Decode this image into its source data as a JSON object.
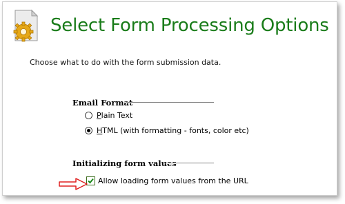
{
  "page": {
    "title": "Select Form Processing Options",
    "description": "Choose what to do with the form submission data."
  },
  "email_format": {
    "heading": "Email Format",
    "options": [
      {
        "hotkey": "P",
        "rest": "lain Text",
        "selected": false
      },
      {
        "hotkey": "H",
        "rest": "TML (with formatting - fonts, color etc)",
        "selected": true
      }
    ]
  },
  "initializing": {
    "heading": "Initializing form values",
    "checkbox_label": "Allow loading form values from the URL",
    "checked": true
  },
  "icons": {
    "header": "form-gear-icon",
    "pointer": "red-arrow-icon"
  },
  "colors": {
    "title": "#1a7c1a",
    "arrow": "#e02020"
  }
}
